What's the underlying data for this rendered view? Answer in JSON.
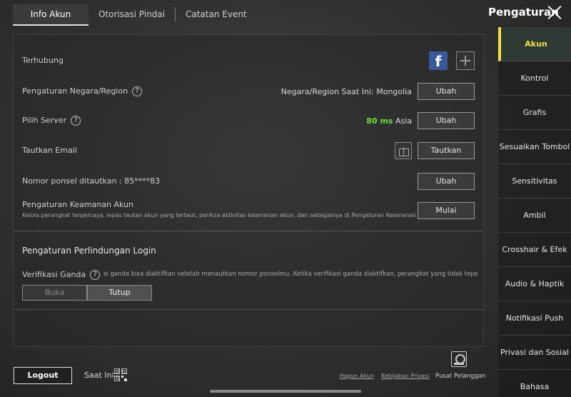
{
  "tabs": [
    {
      "label": "Info Akun",
      "active": true
    },
    {
      "label": "Otorisasi Pindai"
    },
    {
      "label": "Catatan Event"
    }
  ],
  "header": {
    "title": "Pengaturan"
  },
  "account": {
    "linked_label": "Terhubung",
    "region_label": "Pengaturan Negara/Region",
    "region_value": "Negara/Region Saat Ini: Mongolia",
    "region_button": "Ubah",
    "server_label": "Pilih Server",
    "server_ping": "80 ms",
    "server_name": "Asia",
    "server_button": "Ubah",
    "email_label": "Tautkan Email",
    "email_button": "Tautkan",
    "phone_label": "Nomor ponsel ditautkan : 85****83",
    "phone_button": "Ubah",
    "security_label": "Pengaturan Keamanan Akun",
    "security_desc": "Kelola perangkat terpercaya, lepas tautan akun yang tertaut, periksa aktivitas keamanan akun, dan sebagainya di Pengaturan Keamanan Akun",
    "security_button": "Mulai"
  },
  "login_protection": {
    "title": "Pengaturan Perlindungan Login",
    "verification_label": "Verifikasi Ganda",
    "verification_desc": "si ganda bisa diaktifkan setelah menautkan nomor ponselmu. Ketika verifikasi ganda diaktifkan, perangkat yang tidak tepercaya di",
    "open_label": "Buka",
    "close_label": "Tutup"
  },
  "sidebar": {
    "items": [
      {
        "label": "Akun",
        "active": true
      },
      {
        "label": "Kontrol"
      },
      {
        "label": "Grafis"
      },
      {
        "label": "Sesuaikan Tombol"
      },
      {
        "label": "Sensitivitas"
      },
      {
        "label": "Ambil"
      },
      {
        "label": "Crosshair & Efek"
      },
      {
        "label": "Audio & Haptik"
      },
      {
        "label": "Notifikasi Push"
      },
      {
        "label": "Privasi dan Sosial"
      },
      {
        "label": "Bahasa"
      }
    ]
  },
  "footer": {
    "logout": "Logout",
    "scan_now": "Saat Ini",
    "delete_account": "Hapus Akun",
    "privacy_policy": "Kebijakan Privasi",
    "support": "Pusat Pelanggan"
  },
  "colors": {
    "ping_good": "#6ee03a",
    "facebook": "#3b5998",
    "sidebar_active": "#f2e04a"
  },
  "icons": {
    "facebook": "f"
  }
}
